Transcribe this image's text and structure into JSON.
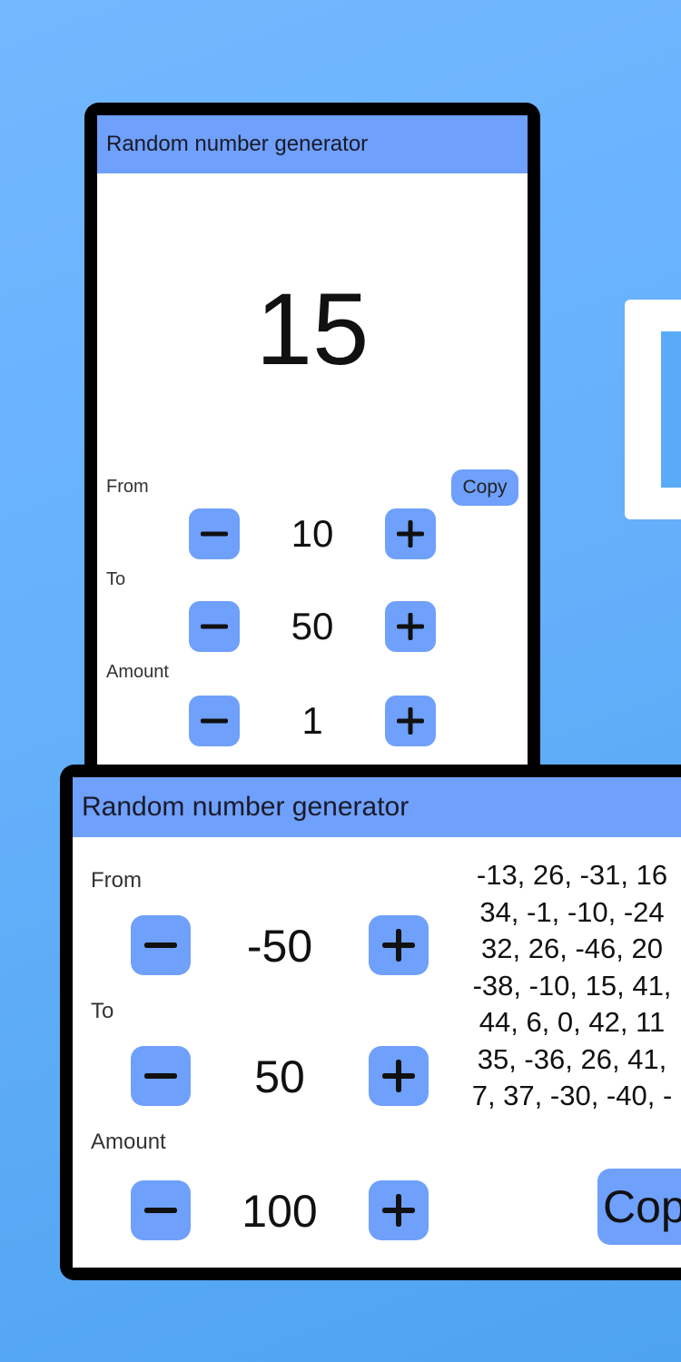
{
  "colors": {
    "background": "#65b0fb",
    "appbar": "#6fa0fb",
    "button": "#6fa0fb",
    "frame": "#000000"
  },
  "screen_single": {
    "app_title": "Random number generator",
    "result": "15",
    "copy_label": "Copy",
    "from": {
      "label": "From",
      "value": "10"
    },
    "to": {
      "label": "To",
      "value": "50"
    },
    "amount": {
      "label": "Amount",
      "value": "1"
    },
    "decrement_icon": "minus-icon",
    "increment_icon": "plus-icon"
  },
  "screen_multi": {
    "app_title": "Random number generator",
    "from": {
      "label": "From",
      "value": "-50"
    },
    "to": {
      "label": "To",
      "value": "50"
    },
    "amount": {
      "label": "Amount",
      "value": "100"
    },
    "copy_label": "Copy",
    "results_lines": [
      "-13, 26, -31, 16",
      "34, -1, -10, -24",
      "32, 26, -46, 20",
      "-38, -10, 15, 41,",
      "44, 6, 0, 42, 11",
      "35, -36, 26, 41,",
      "7, 37, -30, -40, -"
    ]
  }
}
